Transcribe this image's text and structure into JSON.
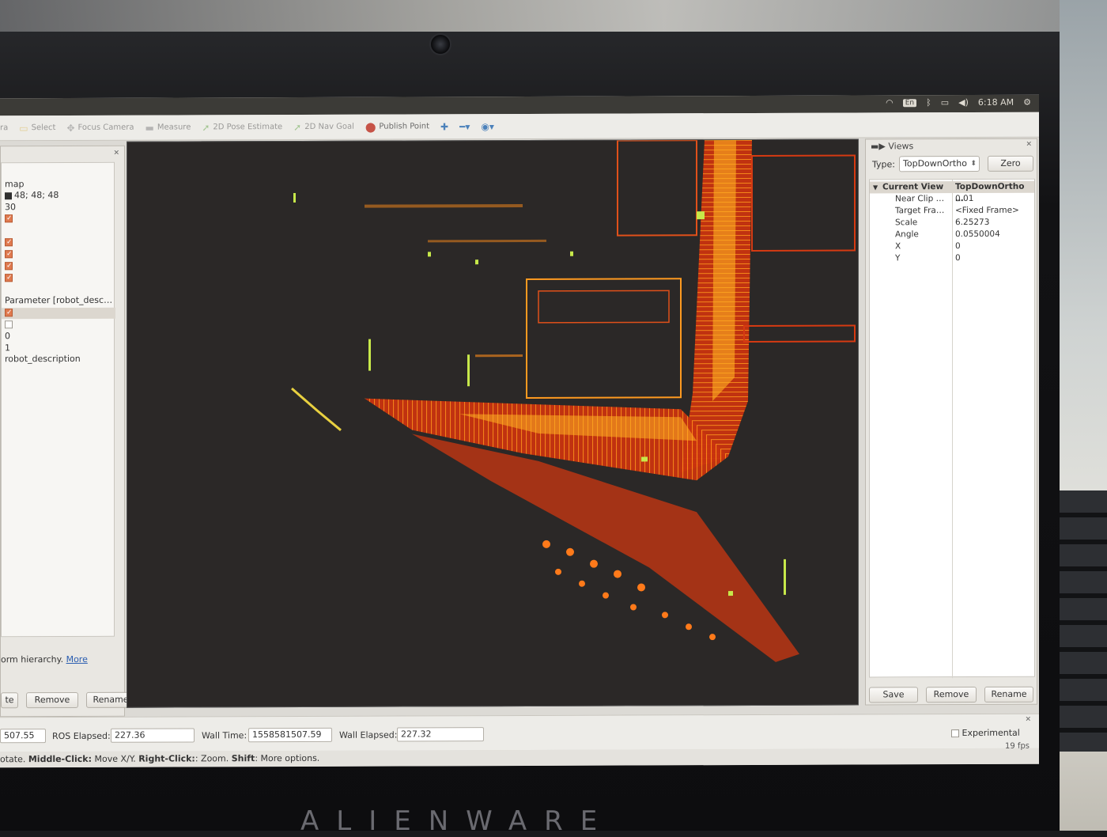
{
  "tray": {
    "lang": "En",
    "time": "6:18 AM"
  },
  "toolbar": {
    "interact_partial": "ra",
    "select": "Select",
    "focus_camera": "Focus Camera",
    "measure": "Measure",
    "pose_estimate": "2D Pose Estimate",
    "nav_goal": "2D Nav Goal",
    "publish_point": "Publish Point"
  },
  "displays": {
    "fixed_frame": "map",
    "bg_color": "48; 48; 48",
    "frame_rate": "30",
    "robot_model_param": "Parameter [robot_desc…",
    "alpha_zero": "0",
    "alpha_one": "1",
    "robot_description": "robot_description",
    "help_text": "orm hierarchy.",
    "help_more": "More",
    "btn_add_partial": "te",
    "btn_remove": "Remove",
    "btn_rename": "Rename"
  },
  "views": {
    "title": "Views",
    "type_label": "Type:",
    "type_value": "TopDownOrtho",
    "zero": "Zero",
    "current_view_label": "Current View",
    "current_view_value": "TopDownOrtho …",
    "props": [
      {
        "k": "Near Clip …",
        "v": "0.01"
      },
      {
        "k": "Target Fra…",
        "v": "<Fixed Frame>"
      },
      {
        "k": "Scale",
        "v": "6.25273"
      },
      {
        "k": "Angle",
        "v": "0.0550004"
      },
      {
        "k": "X",
        "v": "0"
      },
      {
        "k": "Y",
        "v": "0"
      }
    ],
    "btn_save": "Save",
    "btn_remove": "Remove",
    "btn_rename": "Rename"
  },
  "time": {
    "ros_time_partial": "507.55",
    "ros_elapsed_label": "ROS Elapsed:",
    "ros_elapsed": "227.36",
    "wall_time_label": "Wall Time:",
    "wall_time": "1558581507.59",
    "wall_elapsed_label": "Wall Elapsed:",
    "wall_elapsed": "227.32",
    "experimental": "Experimental",
    "fps": "19 fps"
  },
  "status": {
    "prefix": "otate. ",
    "middle_click": "Middle-Click:",
    "middle_text": " Move X/Y. ",
    "right_click": "Right-Click:",
    "right_text": ": Zoom. ",
    "shift": "Shift",
    "shift_text": ": More options."
  },
  "brand": "ALIENWARE"
}
